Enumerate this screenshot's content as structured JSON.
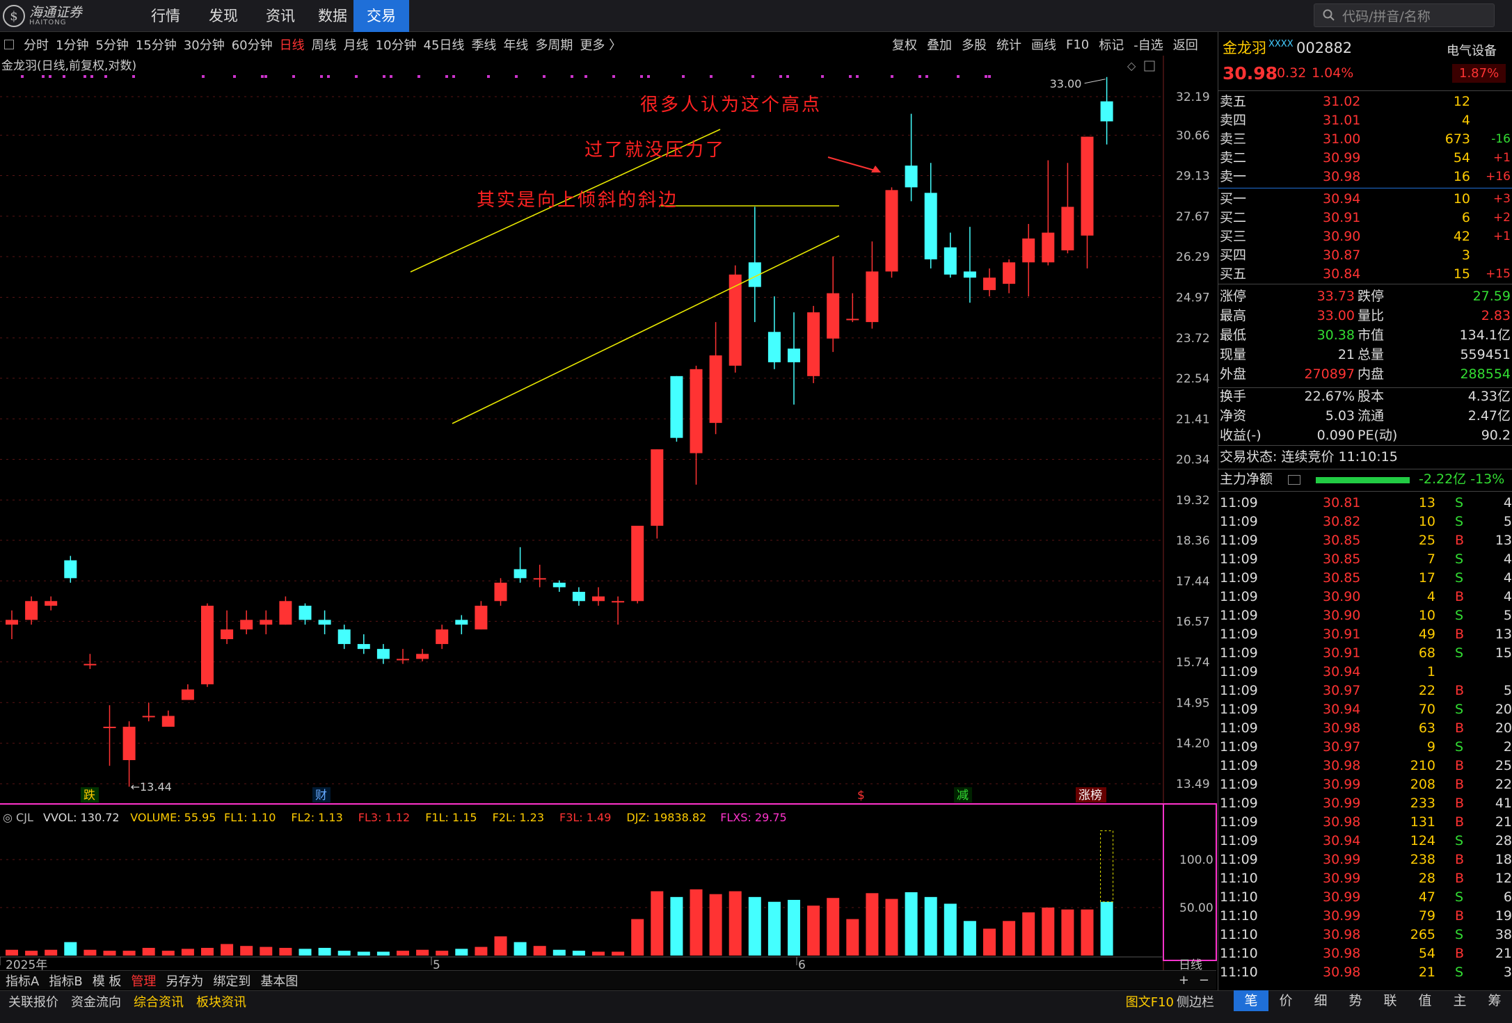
{
  "app": {
    "logo_text": "海通证券",
    "logo_sub": "HAITONG",
    "logo_glyph": "$",
    "nav": [
      "行情",
      "发现",
      "资讯",
      "数据",
      "交易"
    ],
    "nav_active": 4,
    "search_placeholder": "代码/拼音/名称",
    "search_icon": "search-icon"
  },
  "toolbar": {
    "timeframes": [
      "分时",
      "1分钟",
      "5分钟",
      "15分钟",
      "30分钟",
      "60分钟",
      "日线",
      "周线",
      "月线",
      "10分钟",
      "45日线",
      "季线",
      "年线",
      "多周期",
      "更多 〉"
    ],
    "active_timeframe": "日线",
    "right_tools": [
      "复权",
      "叠加",
      "多股",
      "统计",
      "画线",
      "F10",
      "标记",
      "-自选",
      "返回"
    ]
  },
  "chart_title": "金龙羽(日线,前复权,对数)",
  "colors": {
    "up": "#ff3333",
    "down": "#44ffff",
    "trend": "#e8e800",
    "bg": "#000000",
    "vol_axis": "#ff33cc"
  },
  "annotations": [
    "很多人认为这个高点",
    "过了就没压力了",
    "其实是向上倾斜的斜边"
  ],
  "price_labels": {
    "high": "33.00",
    "low": "13.44"
  },
  "event_marks": [
    "跌",
    "财",
    "$",
    "减",
    "涨榜"
  ],
  "x_labels": [
    "2025年",
    "5",
    "6",
    "日线"
  ],
  "indicator_line": {
    "name": "CJL",
    "items": [
      {
        "t": "VVOL: 130.72",
        "c": "#dddddd"
      },
      {
        "t": "VOLUME: 55.95",
        "c": "#ffcc00"
      },
      {
        "t": "FL1: 1.10",
        "c": "#ffcc00"
      },
      {
        "t": "FL2: 1.13",
        "c": "#ffcc00"
      },
      {
        "t": "FL3: 1.12",
        "c": "#ff3333"
      },
      {
        "t": "F1L: 1.15",
        "c": "#ffcc00"
      },
      {
        "t": "F2L: 1.23",
        "c": "#ffcc00"
      },
      {
        "t": "F3L: 1.49",
        "c": "#ff3333"
      },
      {
        "t": "DJZ: 19838.82",
        "c": "#ffcc00"
      },
      {
        "t": "FLXS: 29.75",
        "c": "#ff33cc"
      }
    ]
  },
  "chart_data": {
    "type": "candlestick",
    "y_ticks": [
      "32.19",
      "30.66",
      "29.13",
      "27.67",
      "26.29",
      "24.97",
      "23.72",
      "22.54",
      "21.41",
      "20.34",
      "19.32",
      "18.36",
      "17.44",
      "16.57",
      "15.74",
      "14.95",
      "14.20",
      "13.49"
    ],
    "vol_ticks": [
      "100.0",
      "50.00"
    ],
    "candles": [
      {
        "o": 16.5,
        "c": 16.6,
        "h": 16.8,
        "l": 16.2
      },
      {
        "o": 16.6,
        "c": 17.0,
        "h": 17.1,
        "l": 16.5
      },
      {
        "o": 16.9,
        "c": 17.0,
        "h": 17.1,
        "l": 16.8
      },
      {
        "o": 17.9,
        "c": 17.5,
        "h": 18.0,
        "l": 17.4
      },
      {
        "o": 15.7,
        "c": 15.7,
        "h": 15.9,
        "l": 15.6
      },
      {
        "o": 14.5,
        "c": 14.5,
        "h": 14.9,
        "l": 13.8
      },
      {
        "o": 13.9,
        "c": 14.5,
        "h": 14.6,
        "l": 13.44
      },
      {
        "o": 14.7,
        "c": 14.7,
        "h": 14.95,
        "l": 14.6
      },
      {
        "o": 14.5,
        "c": 14.7,
        "h": 14.8,
        "l": 14.5
      },
      {
        "o": 15.0,
        "c": 15.2,
        "h": 15.3,
        "l": 15.0
      },
      {
        "o": 15.3,
        "c": 16.9,
        "h": 16.95,
        "l": 15.25
      },
      {
        "o": 16.2,
        "c": 16.4,
        "h": 16.8,
        "l": 16.1
      },
      {
        "o": 16.4,
        "c": 16.6,
        "h": 16.8,
        "l": 16.3
      },
      {
        "o": 16.5,
        "c": 16.6,
        "h": 16.8,
        "l": 16.3
      },
      {
        "o": 16.5,
        "c": 17.0,
        "h": 17.1,
        "l": 16.5
      },
      {
        "o": 16.9,
        "c": 16.6,
        "h": 16.95,
        "l": 16.5
      },
      {
        "o": 16.6,
        "c": 16.5,
        "h": 16.8,
        "l": 16.3
      },
      {
        "o": 16.4,
        "c": 16.1,
        "h": 16.5,
        "l": 16.0
      },
      {
        "o": 16.1,
        "c": 16.0,
        "h": 16.3,
        "l": 15.9
      },
      {
        "o": 16.0,
        "c": 15.8,
        "h": 16.1,
        "l": 15.7
      },
      {
        "o": 15.8,
        "c": 15.8,
        "h": 16.0,
        "l": 15.7
      },
      {
        "o": 15.8,
        "c": 15.9,
        "h": 16.0,
        "l": 15.75
      },
      {
        "o": 16.1,
        "c": 16.4,
        "h": 16.5,
        "l": 16.0
      },
      {
        "o": 16.6,
        "c": 16.5,
        "h": 16.7,
        "l": 16.3
      },
      {
        "o": 16.4,
        "c": 16.9,
        "h": 17.0,
        "l": 16.4
      },
      {
        "o": 17.0,
        "c": 17.4,
        "h": 17.5,
        "l": 16.9
      },
      {
        "o": 17.7,
        "c": 17.5,
        "h": 18.2,
        "l": 17.4
      },
      {
        "o": 17.5,
        "c": 17.5,
        "h": 17.8,
        "l": 17.3
      },
      {
        "o": 17.4,
        "c": 17.3,
        "h": 17.45,
        "l": 17.2
      },
      {
        "o": 17.2,
        "c": 17.0,
        "h": 17.3,
        "l": 16.9
      },
      {
        "o": 17.0,
        "c": 17.1,
        "h": 17.3,
        "l": 16.9
      },
      {
        "o": 17.0,
        "c": 17.0,
        "h": 17.1,
        "l": 16.5
      },
      {
        "o": 17.0,
        "c": 18.7,
        "h": 18.7,
        "l": 16.95
      },
      {
        "o": 18.7,
        "c": 20.6,
        "h": 20.6,
        "l": 18.4
      },
      {
        "o": 22.6,
        "c": 20.9,
        "h": 22.6,
        "l": 20.8
      },
      {
        "o": 20.5,
        "c": 22.8,
        "h": 22.9,
        "l": 19.7
      },
      {
        "o": 21.3,
        "c": 23.2,
        "h": 24.2,
        "l": 21.0
      },
      {
        "o": 22.9,
        "c": 25.7,
        "h": 26.0,
        "l": 22.7
      },
      {
        "o": 26.1,
        "c": 25.3,
        "h": 28.0,
        "l": 24.2
      },
      {
        "o": 23.9,
        "c": 23.0,
        "h": 25.0,
        "l": 22.8
      },
      {
        "o": 23.4,
        "c": 23.0,
        "h": 24.5,
        "l": 21.8
      },
      {
        "o": 22.6,
        "c": 24.5,
        "h": 24.7,
        "l": 22.4
      },
      {
        "o": 23.7,
        "c": 25.1,
        "h": 26.3,
        "l": 23.3
      },
      {
        "o": 24.3,
        "c": 24.3,
        "h": 25.1,
        "l": 24.2
      },
      {
        "o": 24.2,
        "c": 25.8,
        "h": 26.8,
        "l": 24.0
      },
      {
        "o": 25.8,
        "c": 28.6,
        "h": 28.7,
        "l": 25.6
      },
      {
        "o": 29.5,
        "c": 28.7,
        "h": 31.5,
        "l": 28.2
      },
      {
        "o": 28.5,
        "c": 26.2,
        "h": 29.6,
        "l": 25.9
      },
      {
        "o": 26.6,
        "c": 25.7,
        "h": 27.1,
        "l": 25.6
      },
      {
        "o": 25.8,
        "c": 25.6,
        "h": 27.3,
        "l": 24.8
      },
      {
        "o": 25.2,
        "c": 25.6,
        "h": 25.9,
        "l": 25.0
      },
      {
        "o": 25.4,
        "c": 26.1,
        "h": 26.2,
        "l": 25.1
      },
      {
        "o": 26.1,
        "c": 26.9,
        "h": 27.4,
        "l": 25.0
      },
      {
        "o": 26.1,
        "c": 27.1,
        "h": 29.7,
        "l": 26.0
      },
      {
        "o": 26.5,
        "c": 28.0,
        "h": 29.6,
        "l": 26.4
      },
      {
        "o": 27.0,
        "c": 30.6,
        "h": 30.6,
        "l": 25.9
      },
      {
        "o": 32.0,
        "c": 31.2,
        "h": 33.0,
        "l": 30.3
      }
    ],
    "volumes": [
      6,
      5,
      6,
      14,
      6,
      5,
      5,
      8,
      5,
      7,
      8,
      12,
      10,
      9,
      8,
      7,
      8,
      5,
      4,
      4,
      5,
      6,
      5,
      7,
      9,
      20,
      14,
      10,
      6,
      5,
      4,
      4,
      38,
      67,
      61,
      69,
      64,
      67,
      61,
      56,
      58,
      52,
      60,
      38,
      65,
      59,
      66,
      61,
      54,
      36,
      28,
      36,
      45,
      50,
      48,
      48,
      55.95
    ],
    "trendlines": [
      {
        "x1": 590,
        "y1": 202,
        "x2": 1035,
        "y2": -3
      },
      {
        "x1": 650,
        "y1": 420,
        "x2": 1206,
        "y2": 150
      },
      {
        "x1": 950,
        "y1": 107,
        "x2": 1206,
        "y2": 107
      }
    ]
  },
  "stock": {
    "name": "金龙羽",
    "code_prefix": "XXXX",
    "code": "002882",
    "sector": "电气设备",
    "sector_chg": "1.87%",
    "price": "30.98",
    "chg": "0.32",
    "pct": "1.04%",
    "asks": [
      [
        "卖五",
        "31.02",
        "12",
        ""
      ],
      [
        "卖四",
        "31.01",
        "4",
        ""
      ],
      [
        "卖三",
        "31.00",
        "673",
        "-16"
      ],
      [
        "卖二",
        "30.99",
        "54",
        "+1"
      ],
      [
        "卖一",
        "30.98",
        "16",
        "+16"
      ]
    ],
    "bids": [
      [
        "买一",
        "30.94",
        "10",
        "+3"
      ],
      [
        "买二",
        "30.91",
        "6",
        "+2"
      ],
      [
        "买三",
        "30.90",
        "42",
        "+1"
      ],
      [
        "买四",
        "30.87",
        "3",
        ""
      ],
      [
        "买五",
        "30.84",
        "15",
        "+15"
      ]
    ],
    "stats": [
      [
        "涨停",
        "33.73",
        "跌停",
        "27.59"
      ],
      [
        "最高",
        "33.00",
        "量比",
        "2.83"
      ],
      [
        "最低",
        "30.38",
        "市值",
        "134.1亿"
      ],
      [
        "现量",
        "21",
        "总量",
        "559451"
      ],
      [
        "外盘",
        "270897",
        "内盘",
        "288554"
      ],
      [
        "换手",
        "22.67%",
        "股本",
        "4.33亿"
      ],
      [
        "净资",
        "5.03",
        "流通",
        "2.47亿"
      ],
      [
        "收益(-)",
        "0.090",
        "PE(动)",
        "90.2"
      ]
    ],
    "status": "交易状态: 连续竞价 11:10:15",
    "flow_label": "主力净额",
    "flow_value": "-2.22亿",
    "flow_pct": "-13%"
  },
  "ticks": [
    [
      "11:09",
      "30.81",
      "13",
      "S",
      "4"
    ],
    [
      "11:09",
      "30.82",
      "10",
      "S",
      "5"
    ],
    [
      "11:09",
      "30.85",
      "25",
      "B",
      "13"
    ],
    [
      "11:09",
      "30.85",
      "7",
      "S",
      "4"
    ],
    [
      "11:09",
      "30.85",
      "17",
      "S",
      "4"
    ],
    [
      "11:09",
      "30.90",
      "4",
      "B",
      "4"
    ],
    [
      "11:09",
      "30.90",
      "10",
      "S",
      "5"
    ],
    [
      "11:09",
      "30.91",
      "49",
      "B",
      "13"
    ],
    [
      "11:09",
      "30.91",
      "68",
      "S",
      "15"
    ],
    [
      "11:09",
      "30.94",
      "1",
      "",
      ""
    ],
    [
      "11:09",
      "30.97",
      "22",
      "B",
      "5"
    ],
    [
      "11:09",
      "30.94",
      "70",
      "S",
      "20"
    ],
    [
      "11:09",
      "30.98",
      "63",
      "B",
      "20"
    ],
    [
      "11:09",
      "30.97",
      "9",
      "S",
      "2"
    ],
    [
      "11:09",
      "30.98",
      "210",
      "B",
      "25"
    ],
    [
      "11:09",
      "30.99",
      "208",
      "B",
      "22"
    ],
    [
      "11:09",
      "30.99",
      "233",
      "B",
      "41"
    ],
    [
      "11:09",
      "30.98",
      "131",
      "B",
      "21"
    ],
    [
      "11:09",
      "30.94",
      "124",
      "S",
      "28"
    ],
    [
      "11:09",
      "30.99",
      "238",
      "B",
      "18"
    ],
    [
      "11:10",
      "30.99",
      "28",
      "B",
      "12"
    ],
    [
      "11:10",
      "30.99",
      "47",
      "S",
      "6"
    ],
    [
      "11:10",
      "30.99",
      "79",
      "B",
      "19"
    ],
    [
      "11:10",
      "30.98",
      "265",
      "S",
      "38"
    ],
    [
      "11:10",
      "30.98",
      "54",
      "B",
      "21"
    ],
    [
      "11:10",
      "30.98",
      "21",
      "S",
      "3"
    ]
  ],
  "bottom_tabs": [
    "指标A",
    "指标B",
    "模 板",
    "管理",
    "另存为",
    "绑定到",
    "基本图"
  ],
  "bottom_tabs_active": "管理",
  "bottom_links": [
    "关联报价",
    "资金流向",
    "综合资讯",
    "板块资讯"
  ],
  "f10_label": "图文F10",
  "side_label": "侧边栏",
  "right_tabs": [
    "笔",
    "价",
    "细",
    "势",
    "联",
    "值",
    "主",
    "筹"
  ],
  "right_tab_active": "笔"
}
